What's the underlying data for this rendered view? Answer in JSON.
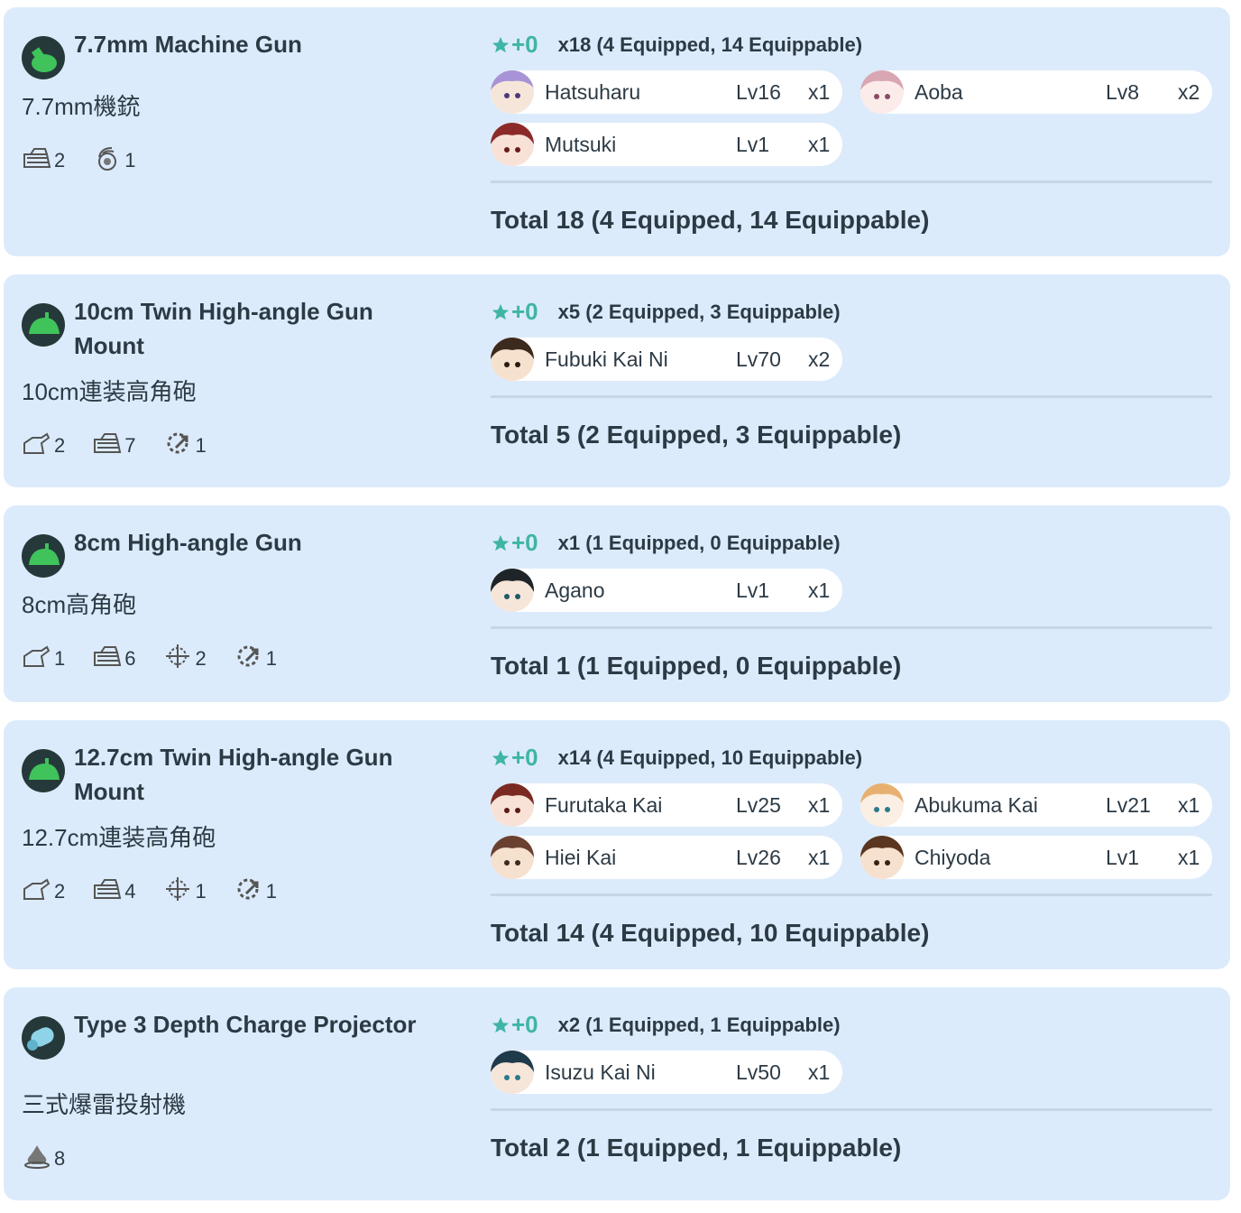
{
  "items": [
    {
      "name": "7.7mm Machine Gun",
      "name_jp": "7.7mm機銃",
      "icon": "aa-gun-icon",
      "stats": [
        {
          "icon": "anti-air-icon",
          "value": "2"
        },
        {
          "icon": "evasion-icon",
          "value": "1"
        }
      ],
      "star_label": "+0",
      "count_summary": "x18 (4 Equipped, 14 Equippable)",
      "ships": [
        {
          "name": "Hatsuharu",
          "level": "Lv16",
          "qty": "x1"
        },
        {
          "name": "Aoba",
          "level": "Lv8",
          "qty": "x2"
        },
        {
          "name": "Mutsuki",
          "level": "Lv1",
          "qty": "x1"
        }
      ],
      "total": "Total 18 (4 Equipped, 14 Equippable)"
    },
    {
      "name": "10cm Twin High-angle Gun Mount",
      "name_jp": "10cm連装高角砲",
      "icon": "high-angle-gun-icon",
      "stats": [
        {
          "icon": "firepower-icon",
          "value": "2"
        },
        {
          "icon": "anti-air-icon",
          "value": "7"
        },
        {
          "icon": "armor-icon",
          "value": "1"
        }
      ],
      "star_label": "+0",
      "count_summary": "x5 (2 Equipped, 3 Equippable)",
      "ships": [
        {
          "name": "Fubuki Kai Ni",
          "level": "Lv70",
          "qty": "x2"
        }
      ],
      "total": "Total 5 (2 Equipped, 3 Equippable)"
    },
    {
      "name": "8cm High-angle Gun",
      "name_jp": "8cm高角砲",
      "icon": "high-angle-gun-icon",
      "stats": [
        {
          "icon": "firepower-icon",
          "value": "1"
        },
        {
          "icon": "anti-air-icon",
          "value": "6"
        },
        {
          "icon": "accuracy-icon",
          "value": "2"
        },
        {
          "icon": "armor-icon",
          "value": "1"
        }
      ],
      "star_label": "+0",
      "count_summary": "x1 (1 Equipped, 0 Equippable)",
      "ships": [
        {
          "name": "Agano",
          "level": "Lv1",
          "qty": "x1"
        }
      ],
      "total": "Total 1 (1 Equipped, 0 Equippable)"
    },
    {
      "name": "12.7cm Twin High-angle Gun Mount",
      "name_jp": "12.7cm連装高角砲",
      "icon": "high-angle-gun-icon",
      "stats": [
        {
          "icon": "firepower-icon",
          "value": "2"
        },
        {
          "icon": "anti-air-icon",
          "value": "4"
        },
        {
          "icon": "accuracy-icon",
          "value": "1"
        },
        {
          "icon": "armor-icon",
          "value": "1"
        }
      ],
      "star_label": "+0",
      "count_summary": "x14 (4 Equipped, 10 Equippable)",
      "ships": [
        {
          "name": "Furutaka Kai",
          "level": "Lv25",
          "qty": "x1"
        },
        {
          "name": "Abukuma Kai",
          "level": "Lv21",
          "qty": "x1"
        },
        {
          "name": "Hiei Kai",
          "level": "Lv26",
          "qty": "x1"
        },
        {
          "name": "Chiyoda",
          "level": "Lv1",
          "qty": "x1"
        }
      ],
      "total": "Total 14 (4 Equipped, 10 Equippable)"
    },
    {
      "name": "Type 3 Depth Charge Projector",
      "name_jp": "三式爆雷投射機",
      "icon": "depth-charge-icon",
      "stats": [
        {
          "icon": "anti-submarine-icon",
          "value": "8"
        }
      ],
      "star_label": "+0",
      "count_summary": "x2 (1 Equipped, 1 Equippable)",
      "ships": [
        {
          "name": "Isuzu Kai Ni",
          "level": "Lv50",
          "qty": "x1"
        }
      ],
      "total": "Total 2 (1 Equipped, 1 Equippable)"
    }
  ],
  "colors": {
    "card_bg": "#dcebfb",
    "star": "#3fb5a7",
    "gun_green": "#3fc35a",
    "depth_cyan": "#8fd3e8"
  }
}
